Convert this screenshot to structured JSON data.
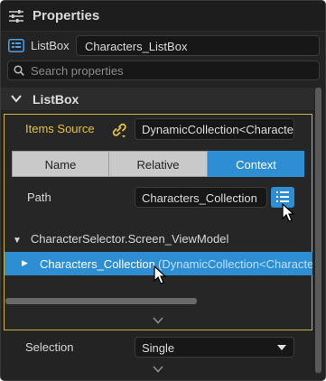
{
  "title": {
    "label": "Properties",
    "icon": "sliders-icon"
  },
  "component": {
    "type_label": "ListBox",
    "name_value": "Characters_ListBox",
    "icon": "listbox-icon"
  },
  "search": {
    "placeholder": "Search properties",
    "icon": "search-icon"
  },
  "section": {
    "label": "ListBox",
    "expanded": true
  },
  "items_source": {
    "label": "Items Source",
    "value": "DynamicCollection<Characte",
    "icon": "link-icon",
    "accent": "#e2c24a"
  },
  "binding_modes": {
    "options": [
      "Name",
      "Relative",
      "Context"
    ],
    "selected": "Context",
    "accent": "#2d8ed3"
  },
  "path": {
    "label": "Path",
    "value": "Characters_Collection",
    "button_icon": "list-icon"
  },
  "tree": {
    "root": {
      "label": "CharacterSelector.Screen_ViewModel",
      "expanded": true
    },
    "selected": {
      "name": "Characters_Collection",
      "type": "(DynamicCollection<Character"
    }
  },
  "selection": {
    "label": "Selection",
    "value": "Single"
  },
  "colors": {
    "panel": "#232323",
    "highlight": "#2d8ed3",
    "border_accent": "#d2b53c"
  }
}
